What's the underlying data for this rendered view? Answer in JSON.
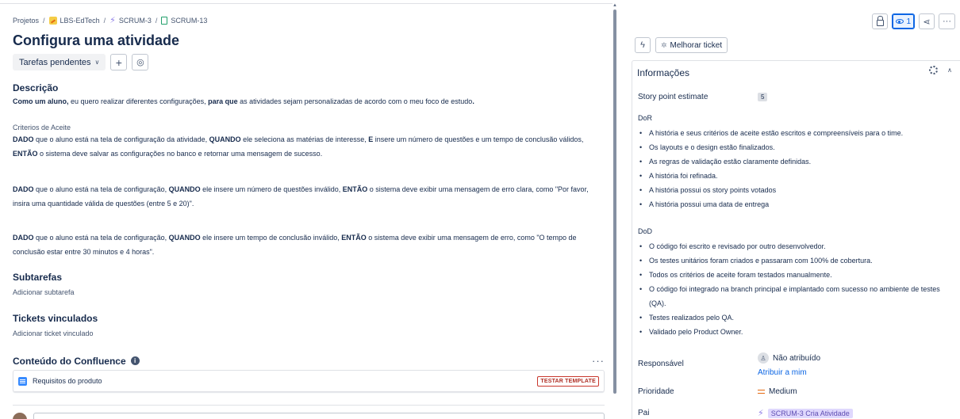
{
  "breadcrumb": {
    "items": [
      {
        "label": "Projetos"
      },
      {
        "label": "LBS-EdTech"
      },
      {
        "label": "SCRUM-3"
      },
      {
        "label": "SCRUM-13"
      }
    ],
    "separator": "/"
  },
  "issue": {
    "title": "Configura uma atividade",
    "status": "Tarefas pendentes",
    "add_label": "+"
  },
  "description": {
    "heading": "Descrição",
    "intro_bold1": "Como um aluno,",
    "intro_text1": " eu quero realizar diferentes configurações, ",
    "intro_bold2": "para que",
    "intro_text2": " as atividades sejam personalizadas de acordo com o meu foco de estudo",
    "intro_end": ".",
    "criteria_heading": "Criterios de Aceite",
    "c1": {
      "b1": "DADO",
      "t1": " que o aluno está na tela de configuração da atividade, ",
      "b2": "QUANDO",
      "t2": " ele seleciona as matérias de interesse, ",
      "b3": "E",
      "t3": " insere um número de questões e um tempo de conclusão válidos, ",
      "b4": "ENTÃO",
      "t4": " o sistema deve salvar as configurações no banco e retornar uma mensagem de sucesso."
    },
    "c2": {
      "b1": "DADO",
      "t1": " que o aluno está na tela de configuração, ",
      "b2": "QUANDO",
      "t2": " ele insere um número de questões inválido, ",
      "b3": "ENTÃO",
      "t3": " o sistema deve exibir uma mensagem de erro clara, como \"Por favor, insira uma quantidade válida de questões (entre 5 e 20)\"."
    },
    "c3": {
      "b1": "DADO",
      "t1": " que o aluno está na tela de configuração, ",
      "b2": "QUANDO",
      "t2": " ele insere um tempo de conclusão inválido, ",
      "b3": "ENTÃO",
      "t3": " o sistema deve exibir uma mensagem de erro, como \"O tempo de conclusão estar entre 30 minutos e 4 horas\"."
    }
  },
  "subtasks": {
    "heading": "Subtarefas",
    "add_label": "Adicionar subtarefa"
  },
  "linked": {
    "heading": "Tickets vinculados",
    "add_label": "Adicionar ticket vinculado"
  },
  "confluence": {
    "heading": "Conteúdo do Confluence",
    "more": "···",
    "item_label": "Requisitos do produto",
    "item_badge": "TESTAR TEMPLATE"
  },
  "toolbar": {
    "watch_count": "1",
    "more": "···",
    "share": "<",
    "ai_bolt": "ϟ",
    "improve_label": "Melhorar ticket"
  },
  "details": {
    "heading": "Informações",
    "story_point_label": "Story point estimate",
    "story_point_value": "5",
    "dor_heading": "DoR",
    "dor_items": [
      "A história e seus critérios de aceite estão escritos e compreensíveis para o time.",
      "Os layouts e o design estão finalizados.",
      "As regras de validação estão claramente definidas.",
      "A história foi refinada.",
      "A história possui os story points votados",
      "A história possui uma data de entrega"
    ],
    "dod_heading": "DoD",
    "dod_items": [
      "O código foi escrito e revisado por outro desenvolvedor.",
      "Os testes unitários foram criados e passaram com 100% de cobertura.",
      "Todos os critérios de aceite foram testados manualmente.",
      "O código foi integrado na branch principal e implantado com sucesso no ambiente de testes (QA).",
      "Testes realizados pelo QA.",
      "Validado pelo Product Owner."
    ],
    "assignee_label": "Responsável",
    "assignee_value": "Não atribuído",
    "assign_me": "Atribuir a mim",
    "priority_label": "Prioridade",
    "priority_value": "Medium",
    "parent_label": "Pai",
    "parent_value": "SCRUM-3 Cria Atividade"
  },
  "colors": {
    "accent": "#0c66e4",
    "epic": "#8f7ee7",
    "priority_medium": "#e56910",
    "badge_red": "#c9372c"
  }
}
